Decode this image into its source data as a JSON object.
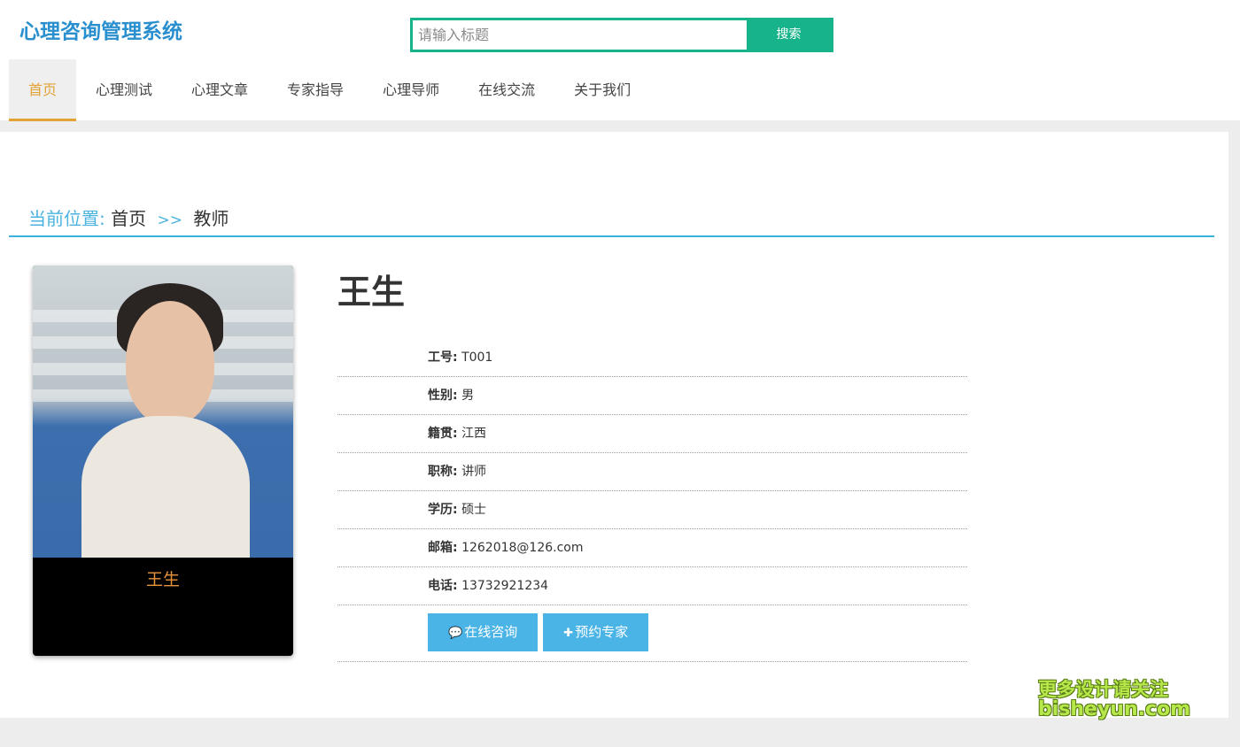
{
  "header": {
    "logo": "心理咨询管理系统",
    "search_placeholder": "请输入标题",
    "search_button": "搜索"
  },
  "nav": {
    "items": [
      "首页",
      "心理测试",
      "心理文章",
      "专家指导",
      "心理导师",
      "在线交流",
      "关于我们"
    ],
    "active_index": 0
  },
  "breadcrumb": {
    "label": "当前位置:",
    "home": "首页",
    "separator": ">>",
    "current": "教师"
  },
  "teacher": {
    "name": "王生",
    "card_name": "王生",
    "fields": [
      {
        "key": "工号:",
        "value": "T001"
      },
      {
        "key": "性别:",
        "value": "男"
      },
      {
        "key": "籍贯:",
        "value": "江西"
      },
      {
        "key": "职称:",
        "value": "讲师"
      },
      {
        "key": "学历:",
        "value": "硕士"
      },
      {
        "key": "邮箱:",
        "value": "1262018@126.com"
      },
      {
        "key": "电话:",
        "value": "13732921234"
      }
    ],
    "consult_button": "在线咨询",
    "reserve_button": "预约专家"
  },
  "watermark": {
    "line1": "更多设计请关注",
    "line2": "bisheyun.com"
  },
  "colors": {
    "logo": "#2a8fcf",
    "search_accent": "#17b38a",
    "nav_active": "#e2a236",
    "breadcrumb_accent": "#4bb3df",
    "action_button": "#4bb4e6",
    "card_name": "#e7933a"
  }
}
